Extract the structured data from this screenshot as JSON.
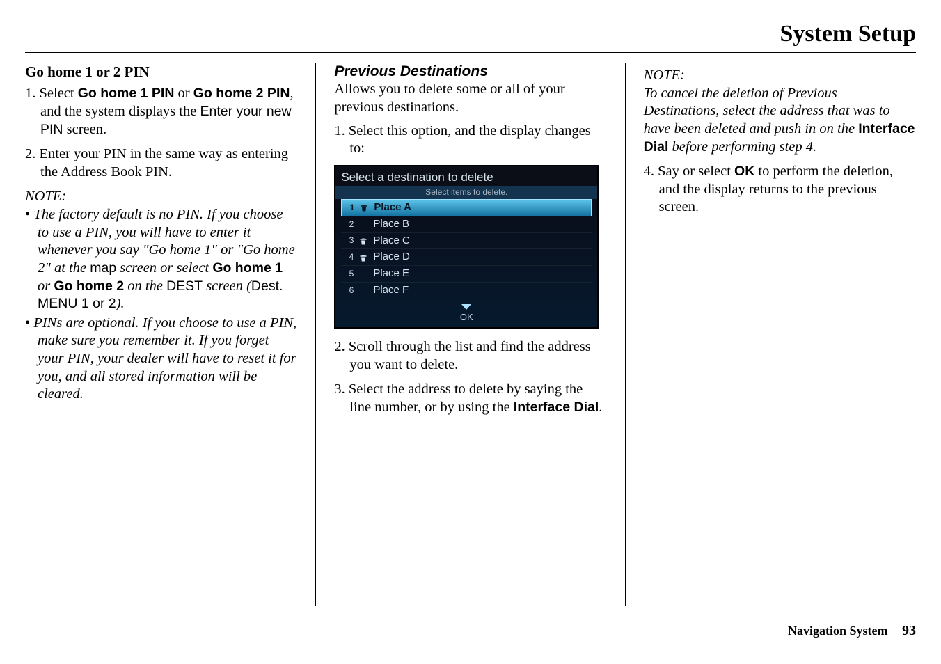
{
  "header": {
    "title": "System Setup"
  },
  "footer": {
    "label": "Navigation System",
    "page": "93"
  },
  "col1": {
    "h": "Go home 1 or 2 PIN",
    "step1_a": "Select ",
    "step1_b1": "Go home 1 PIN",
    "step1_or": " or ",
    "step1_b2": "Go home 2 PIN",
    "step1_c": ", and the system displays the ",
    "step1_d": "Enter your new PIN",
    "step1_e": " screen.",
    "step2": "Enter your PIN in the same way as entering the Address Book PIN.",
    "note_h": "NOTE:",
    "n1_a": "The factory default is no PIN. If you choose to use a PIN, you will have to enter it whenever you say \"Go home 1\" or \"Go home 2\" at the ",
    "n1_map": "map",
    "n1_b": " screen or select ",
    "n1_gh1": "Go home 1",
    "n1_or": " or ",
    "n1_gh2": "Go home 2",
    "n1_c": " on the ",
    "n1_dest": "DEST",
    "n1_d": " screen (",
    "n1_destmenu": "Dest. MENU 1 or 2",
    "n1_e": ").",
    "n2": "PINs are optional. If you choose to use a PIN, make sure you remember it. If you forget your PIN, your dealer will have to reset it for you, and all stored information will be cleared."
  },
  "col2": {
    "h": "Previous Destinations",
    "intro": "Allows you to delete some or all of your previous destinations.",
    "step1": "Select this option, and the display changes to:",
    "screen": {
      "title": "Select a destination to delete",
      "subtitle": "Select items to delete.",
      "items": [
        {
          "n": "1",
          "label": "Place A",
          "trash": true,
          "selected": true
        },
        {
          "n": "2",
          "label": "Place B",
          "trash": false,
          "selected": false
        },
        {
          "n": "3",
          "label": "Place C",
          "trash": true,
          "selected": false
        },
        {
          "n": "4",
          "label": "Place D",
          "trash": true,
          "selected": false
        },
        {
          "n": "5",
          "label": "Place E",
          "trash": false,
          "selected": false
        },
        {
          "n": "6",
          "label": "Place F",
          "trash": false,
          "selected": false
        }
      ],
      "ok": "OK"
    },
    "step2": "Scroll through the list and find the address you want to delete.",
    "step3_a": "Select the address to delete by saying the line number, or by using the ",
    "step3_b": "Interface Dial",
    "step3_c": "."
  },
  "col3": {
    "note_h": "NOTE:",
    "note_a": "To cancel the deletion of Previous Destinations, select the address that was to have been deleted and push in on the ",
    "note_b": "Interface Dial",
    "note_c": " before performing step 4.",
    "step4_a": "Say or select ",
    "step4_b": "OK",
    "step4_c": " to perform the deletion, and the display returns to the previous screen."
  }
}
